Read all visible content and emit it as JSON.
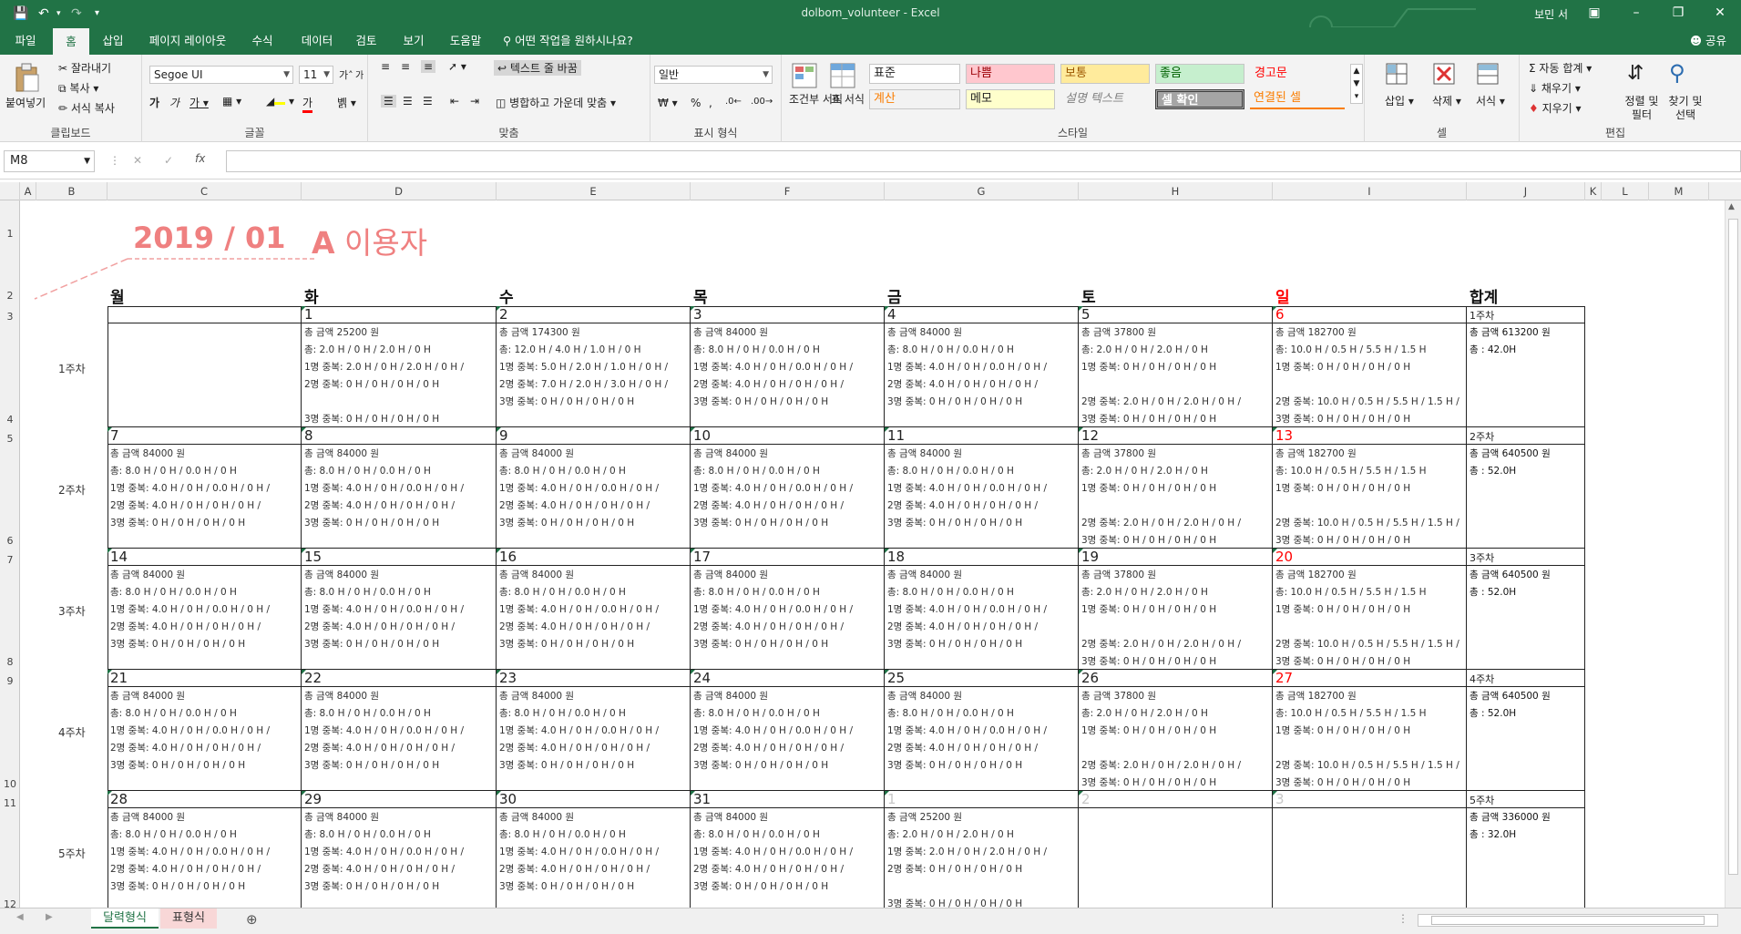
{
  "window": {
    "title": "dolbom_volunteer  -  Excel",
    "user": "보민 서"
  },
  "ribbon_tabs": [
    "파일",
    "홈",
    "삽입",
    "페이지 레이아웃",
    "수식",
    "데이터",
    "검토",
    "보기",
    "도움말"
  ],
  "tell_me": "어떤 작업을 원하시나요?",
  "share": "공유",
  "clipboard": {
    "paste": "붙여넣기",
    "cut": "잘라내기",
    "copy": "복사",
    "format_painter": "서식 복사",
    "group": "클립보드"
  },
  "font": {
    "name": "Segoe UI",
    "size": "11",
    "group": "글꼴"
  },
  "alignment": {
    "wrap": "텍스트 줄 바꿈",
    "merge": "병합하고 가운데 맞춤",
    "group": "맞춤"
  },
  "number": {
    "format": "일반",
    "group": "표시 형식"
  },
  "styles": {
    "conditional": "조건부 서식",
    "table": "표 서식",
    "group": "스타일",
    "cells": [
      {
        "label": "표준",
        "bg": "#ffffff",
        "fg": "#222222"
      },
      {
        "label": "나쁨",
        "bg": "#ffc7ce",
        "fg": "#9c0006"
      },
      {
        "label": "보통",
        "bg": "#ffeb9c",
        "fg": "#9c5700"
      },
      {
        "label": "좋음",
        "bg": "#c6efce",
        "fg": "#006100"
      },
      {
        "label": "경고문",
        "bg": "#f3f3f3",
        "fg": "#ff0000"
      },
      {
        "label": "계산",
        "bg": "#f2f2f2",
        "fg": "#fa7d00"
      },
      {
        "label": "메모",
        "bg": "#ffffcc",
        "fg": "#222222"
      },
      {
        "label": "설명 텍스트",
        "bg": "#f3f3f3",
        "fg": "#7f7f7f"
      },
      {
        "label": "셀 확인",
        "bg": "#a5a5a5",
        "fg": "#ffffff"
      },
      {
        "label": "연결된 셀",
        "bg": "#f3f3f3",
        "fg": "#fa7d00"
      }
    ]
  },
  "cells_group": {
    "insert": "삽입",
    "delete": "삭제",
    "format": "서식",
    "group": "셀"
  },
  "editing": {
    "autosum": "자동 합계",
    "fill": "채우기",
    "clear": "지우기",
    "sort": "정렬 및 필터",
    "find": "찾기 및 선택",
    "group": "편집"
  },
  "namebox": "M8",
  "columns": [
    "A",
    "B",
    "C",
    "D",
    "E",
    "F",
    "G",
    "H",
    "I",
    "J",
    "K",
    "L",
    "M"
  ],
  "rows": [
    "1",
    "2",
    "3",
    "4",
    "5",
    "6",
    "7",
    "8",
    "9",
    "10",
    "11",
    "12"
  ],
  "calendar": {
    "year_month": "2019 / 01",
    "user_letter": "A",
    "user_suffix": " 이용자",
    "day_headers": [
      "월",
      "화",
      "수",
      "목",
      "금",
      "토",
      "일",
      "합계"
    ],
    "weeks": [
      {
        "label": "1주차",
        "days": [
          {
            "num": "",
            "lines": []
          },
          {
            "num": "1",
            "lines": [
              "총 금액  25200 원",
              "총: 2.0 H / 0 H / 2.0 H / 0 H",
              "1명 중복: 2.0 H / 0 H / 2.0 H / 0 H /",
              "2명 중복:  0 H / 0 H / 0 H / 0 H",
              "",
              "3명 중복:  0 H / 0 H / 0 H / 0 H"
            ]
          },
          {
            "num": "2",
            "lines": [
              "총 금액  174300 원",
              "총: 12.0 H / 4.0 H / 1.0 H / 0 H",
              "1명 중복: 5.0 H / 2.0 H / 1.0 H / 0 H /",
              "2명 중복: 7.0 H / 2.0 H / 3.0 H / 0 H /",
              "3명 중복:  0 H / 0 H / 0 H / 0 H"
            ]
          },
          {
            "num": "3",
            "lines": [
              "총 금액  84000 원",
              "총: 8.0 H / 0 H / 0.0 H / 0 H",
              "1명 중복: 4.0 H / 0 H / 0.0 H / 0 H /",
              "2명 중복: 4.0 H / 0 H / 0 H / 0 H /",
              "3명 중복:  0 H / 0 H / 0 H / 0 H"
            ]
          },
          {
            "num": "4",
            "lines": [
              "총 금액  84000 원",
              "총: 8.0 H / 0 H / 0.0 H / 0 H",
              "1명 중복: 4.0 H / 0 H / 0.0 H / 0 H /",
              "2명 중복: 4.0 H / 0 H / 0 H / 0 H /",
              "3명 중복:  0 H / 0 H / 0 H / 0 H"
            ]
          },
          {
            "num": "5",
            "lines": [
              "총 금액  37800 원",
              "총: 2.0 H / 0 H / 2.0 H / 0 H",
              "1명 중복:  0 H / 0 H / 0 H / 0 H",
              "",
              "2명 중복: 2.0 H / 0 H / 2.0 H / 0 H /",
              "3명 중복:  0 H / 0 H / 0 H / 0 H"
            ]
          },
          {
            "num": "6",
            "lines": [
              "총 금액  182700 원",
              "총: 10.0 H / 0.5 H / 5.5 H / 1.5 H",
              "1명 중복:  0 H / 0 H / 0 H / 0 H",
              "",
              "2명 중복: 10.0 H / 0.5 H / 5.5 H / 1.5 H /",
              "3명 중복:  0 H / 0 H / 0 H / 0 H"
            ]
          },
          {
            "num": "1주차",
            "lines": [
              "총 금액 613200 원",
              "총 : 42.0H"
            ]
          }
        ]
      },
      {
        "label": "2주차",
        "days": [
          {
            "num": "7",
            "lines": [
              "총 금액  84000 원",
              "총: 8.0 H / 0 H / 0.0 H / 0 H",
              "1명 중복: 4.0 H / 0 H / 0.0 H / 0 H /",
              "2명 중복: 4.0 H / 0 H / 0 H / 0 H /",
              "3명 중복:  0 H / 0 H / 0 H / 0 H"
            ]
          },
          {
            "num": "8",
            "lines": [
              "총 금액  84000 원",
              "총: 8.0 H / 0 H / 0.0 H / 0 H",
              "1명 중복: 4.0 H / 0 H / 0.0 H / 0 H /",
              "2명 중복: 4.0 H / 0 H / 0 H / 0 H /",
              "3명 중복:  0 H / 0 H / 0 H / 0 H"
            ]
          },
          {
            "num": "9",
            "lines": [
              "총 금액  84000 원",
              "총: 8.0 H / 0 H / 0.0 H / 0 H",
              "1명 중복: 4.0 H / 0 H / 0.0 H / 0 H /",
              "2명 중복: 4.0 H / 0 H / 0 H / 0 H /",
              "3명 중복:  0 H / 0 H / 0 H / 0 H"
            ]
          },
          {
            "num": "10",
            "lines": [
              "총 금액  84000 원",
              "총: 8.0 H / 0 H / 0.0 H / 0 H",
              "1명 중복: 4.0 H / 0 H / 0.0 H / 0 H /",
              "2명 중복: 4.0 H / 0 H / 0 H / 0 H /",
              "3명 중복:  0 H / 0 H / 0 H / 0 H"
            ]
          },
          {
            "num": "11",
            "lines": [
              "총 금액  84000 원",
              "총: 8.0 H / 0 H / 0.0 H / 0 H",
              "1명 중복: 4.0 H / 0 H / 0.0 H / 0 H /",
              "2명 중복: 4.0 H / 0 H / 0 H / 0 H /",
              "3명 중복:  0 H / 0 H / 0 H / 0 H"
            ]
          },
          {
            "num": "12",
            "lines": [
              "총 금액  37800 원",
              "총: 2.0 H / 0 H / 2.0 H / 0 H",
              "1명 중복:  0 H / 0 H / 0 H / 0 H",
              "",
              "2명 중복: 2.0 H / 0 H / 2.0 H / 0 H /",
              "3명 중복:  0 H / 0 H / 0 H / 0 H"
            ]
          },
          {
            "num": "13",
            "lines": [
              "총 금액  182700 원",
              "총: 10.0 H / 0.5 H / 5.5 H / 1.5 H",
              "1명 중복:  0 H / 0 H / 0 H / 0 H",
              "",
              "2명 중복: 10.0 H / 0.5 H / 5.5 H / 1.5 H /",
              "3명 중복:  0 H / 0 H / 0 H / 0 H"
            ]
          },
          {
            "num": "2주차",
            "lines": [
              "총 금액 640500 원",
              "총 : 52.0H"
            ]
          }
        ]
      },
      {
        "label": "3주차",
        "days": [
          {
            "num": "14",
            "lines": [
              "총 금액  84000 원",
              "총: 8.0 H / 0 H / 0.0 H / 0 H",
              "1명 중복: 4.0 H / 0 H / 0.0 H / 0 H /",
              "2명 중복: 4.0 H / 0 H / 0 H / 0 H /",
              "3명 중복:  0 H / 0 H / 0 H / 0 H"
            ]
          },
          {
            "num": "15",
            "lines": [
              "총 금액  84000 원",
              "총: 8.0 H / 0 H / 0.0 H / 0 H",
              "1명 중복: 4.0 H / 0 H / 0.0 H / 0 H /",
              "2명 중복: 4.0 H / 0 H / 0 H / 0 H /",
              "3명 중복:  0 H / 0 H / 0 H / 0 H"
            ]
          },
          {
            "num": "16",
            "lines": [
              "총 금액  84000 원",
              "총: 8.0 H / 0 H / 0.0 H / 0 H",
              "1명 중복: 4.0 H / 0 H / 0.0 H / 0 H /",
              "2명 중복: 4.0 H / 0 H / 0 H / 0 H /",
              "3명 중복:  0 H / 0 H / 0 H / 0 H"
            ]
          },
          {
            "num": "17",
            "lines": [
              "총 금액  84000 원",
              "총: 8.0 H / 0 H / 0.0 H / 0 H",
              "1명 중복: 4.0 H / 0 H / 0.0 H / 0 H /",
              "2명 중복: 4.0 H / 0 H / 0 H / 0 H /",
              "3명 중복:  0 H / 0 H / 0 H / 0 H"
            ]
          },
          {
            "num": "18",
            "lines": [
              "총 금액  84000 원",
              "총: 8.0 H / 0 H / 0.0 H / 0 H",
              "1명 중복: 4.0 H / 0 H / 0.0 H / 0 H /",
              "2명 중복: 4.0 H / 0 H / 0 H / 0 H /",
              "3명 중복:  0 H / 0 H / 0 H / 0 H"
            ]
          },
          {
            "num": "19",
            "lines": [
              "총 금액  37800 원",
              "총: 2.0 H / 0 H / 2.0 H / 0 H",
              "1명 중복:  0 H / 0 H / 0 H / 0 H",
              "",
              "2명 중복: 2.0 H / 0 H / 2.0 H / 0 H /",
              "3명 중복:  0 H / 0 H / 0 H / 0 H"
            ]
          },
          {
            "num": "20",
            "lines": [
              "총 금액  182700 원",
              "총: 10.0 H / 0.5 H / 5.5 H / 1.5 H",
              "1명 중복:  0 H / 0 H / 0 H / 0 H",
              "",
              "2명 중복: 10.0 H / 0.5 H / 5.5 H / 1.5 H /",
              "3명 중복:  0 H / 0 H / 0 H / 0 H"
            ]
          },
          {
            "num": "3주차",
            "lines": [
              "총 금액 640500 원",
              "총 : 52.0H"
            ]
          }
        ]
      },
      {
        "label": "4주차",
        "days": [
          {
            "num": "21",
            "lines": [
              "총 금액  84000 원",
              "총: 8.0 H / 0 H / 0.0 H / 0 H",
              "1명 중복: 4.0 H / 0 H / 0.0 H / 0 H /",
              "2명 중복: 4.0 H / 0 H / 0 H / 0 H /",
              "3명 중복:  0 H / 0 H / 0 H / 0 H"
            ]
          },
          {
            "num": "22",
            "lines": [
              "총 금액  84000 원",
              "총: 8.0 H / 0 H / 0.0 H / 0 H",
              "1명 중복: 4.0 H / 0 H / 0.0 H / 0 H /",
              "2명 중복: 4.0 H / 0 H / 0 H / 0 H /",
              "3명 중복:  0 H / 0 H / 0 H / 0 H"
            ]
          },
          {
            "num": "23",
            "lines": [
              "총 금액  84000 원",
              "총: 8.0 H / 0 H / 0.0 H / 0 H",
              "1명 중복: 4.0 H / 0 H / 0.0 H / 0 H /",
              "2명 중복: 4.0 H / 0 H / 0 H / 0 H /",
              "3명 중복:  0 H / 0 H / 0 H / 0 H"
            ]
          },
          {
            "num": "24",
            "lines": [
              "총 금액  84000 원",
              "총: 8.0 H / 0 H / 0.0 H / 0 H",
              "1명 중복: 4.0 H / 0 H / 0.0 H / 0 H /",
              "2명 중복: 4.0 H / 0 H / 0 H / 0 H /",
              "3명 중복:  0 H / 0 H / 0 H / 0 H"
            ]
          },
          {
            "num": "25",
            "lines": [
              "총 금액  84000 원",
              "총: 8.0 H / 0 H / 0.0 H / 0 H",
              "1명 중복: 4.0 H / 0 H / 0.0 H / 0 H /",
              "2명 중복: 4.0 H / 0 H / 0 H / 0 H /",
              "3명 중복:  0 H / 0 H / 0 H / 0 H"
            ]
          },
          {
            "num": "26",
            "lines": [
              "총 금액  37800 원",
              "총: 2.0 H / 0 H / 2.0 H / 0 H",
              "1명 중복:  0 H / 0 H / 0 H / 0 H",
              "",
              "2명 중복: 2.0 H / 0 H / 2.0 H / 0 H /",
              "3명 중복:  0 H / 0 H / 0 H / 0 H"
            ]
          },
          {
            "num": "27",
            "lines": [
              "총 금액  182700 원",
              "총: 10.0 H / 0.5 H / 5.5 H / 1.5 H",
              "1명 중복:  0 H / 0 H / 0 H / 0 H",
              "",
              "2명 중복: 10.0 H / 0.5 H / 5.5 H / 1.5 H /",
              "3명 중복:  0 H / 0 H / 0 H / 0 H"
            ]
          },
          {
            "num": "4주차",
            "lines": [
              "총 금액 640500 원",
              "총 : 52.0H"
            ]
          }
        ]
      },
      {
        "label": "5주차",
        "days": [
          {
            "num": "28",
            "lines": [
              "총 금액  84000 원",
              "총: 8.0 H / 0 H / 0.0 H / 0 H",
              "1명 중복: 4.0 H / 0 H / 0.0 H / 0 H /",
              "2명 중복: 4.0 H / 0 H / 0 H / 0 H /",
              "3명 중복:  0 H / 0 H / 0 H / 0 H"
            ]
          },
          {
            "num": "29",
            "lines": [
              "총 금액  84000 원",
              "총: 8.0 H / 0 H / 0.0 H / 0 H",
              "1명 중복: 4.0 H / 0 H / 0.0 H / 0 H /",
              "2명 중복: 4.0 H / 0 H / 0 H / 0 H /",
              "3명 중복:  0 H / 0 H / 0 H / 0 H"
            ]
          },
          {
            "num": "30",
            "lines": [
              "총 금액  84000 원",
              "총: 8.0 H / 0 H / 0.0 H / 0 H",
              "1명 중복: 4.0 H / 0 H / 0.0 H / 0 H /",
              "2명 중복: 4.0 H / 0 H / 0 H / 0 H /",
              "3명 중복:  0 H / 0 H / 0 H / 0 H"
            ]
          },
          {
            "num": "31",
            "lines": [
              "총 금액  84000 원",
              "총: 8.0 H / 0 H / 0.0 H / 0 H",
              "1명 중복: 4.0 H / 0 H / 0.0 H / 0 H /",
              "2명 중복: 4.0 H / 0 H / 0 H / 0 H /",
              "3명 중복:  0 H / 0 H / 0 H / 0 H"
            ]
          },
          {
            "num": "1",
            "muted": true,
            "lines": [
              "총 금액  25200 원",
              "총: 2.0 H / 0 H / 2.0 H / 0 H",
              "1명 중복: 2.0 H / 0 H / 2.0 H / 0 H /",
              "2명 중복:  0 H / 0 H / 0 H / 0 H",
              "",
              "3명 중복:  0 H / 0 H / 0 H / 0 H"
            ]
          },
          {
            "num": "2",
            "muted": true,
            "lines": []
          },
          {
            "num": "3",
            "muted": true,
            "lines": []
          },
          {
            "num": "5주차",
            "lines": [
              "총 금액 336000 원",
              "총 : 32.0H"
            ]
          }
        ]
      }
    ]
  },
  "sheet_tabs": [
    {
      "label": "달력형식",
      "active": true
    },
    {
      "label": "표형식",
      "active": false
    }
  ]
}
